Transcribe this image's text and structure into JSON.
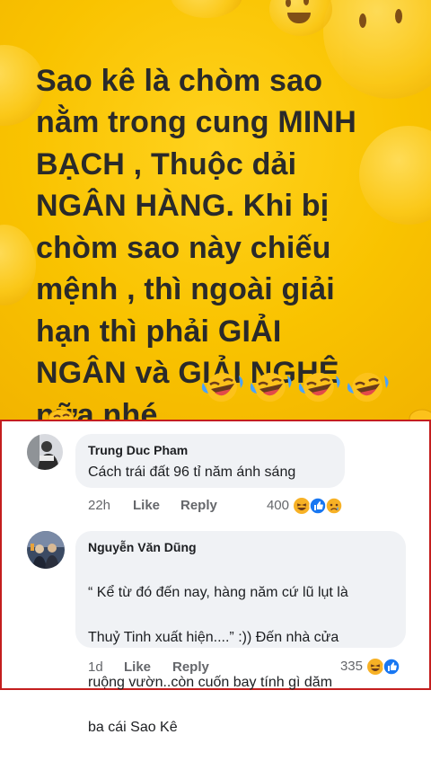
{
  "post": {
    "text": "Sao kê là chòm sao nằm trong cung MINH BẠCH , Thuộc dải NGÂN HÀNG. Khi bị chòm sao này chiếu mệnh , thì ngoài giải hạn thì phải GIẢI NGÂN và GIẢI NGHỆ nữa nhé....",
    "text_lines": [
      "Sao kê là chòm sao",
      "nằm trong cung MINH",
      "BẠCH , Thuộc dải",
      "NGÂN HÀNG. Khi bị",
      "chòm sao này chiếu",
      "mệnh , thì ngoài giải",
      "hạn thì phải GIẢI",
      "NGÂN và GIẢI NGHỆ",
      "nữa nhé...."
    ],
    "emoji": [
      "laughing-emoji",
      "laughing-emoji",
      "laughing-emoji",
      "laughing-emoji"
    ],
    "background_color": "#f9c300",
    "text_color": "#2a2a2a"
  },
  "comments": [
    {
      "author": "Trung Duc Pham",
      "text": "Cách trái đất 96 tỉ năm ánh sáng",
      "time": "22h",
      "like_label": "Like",
      "reply_label": "Reply",
      "reaction_count": "400",
      "reactions": [
        "haha-icon",
        "like-icon",
        "sad-icon"
      ]
    },
    {
      "author": "Nguyễn Văn Dũng",
      "text": "“ Kể từ đó đến nay, hàng năm cứ lũ lụt là Thuỷ Tinh xuất hiện....” :)) Đến nhà cửa ruộng vườn..còn cuốn bay tính gì dăm ba cái Sao Kê",
      "text_lines": [
        "“ Kể từ đó đến nay, hàng năm cứ lũ lụt là",
        "Thuỷ Tinh xuất hiện....” :)) Đến nhà cửa",
        "ruộng vườn..còn cuốn bay tính gì dăm",
        "ba cái Sao Kê"
      ],
      "time": "1d",
      "like_label": "Like",
      "reply_label": "Reply",
      "reaction_count": "335",
      "reactions": [
        "haha-icon",
        "like-icon"
      ]
    }
  ],
  "colors": {
    "panel_border": "#c41e1e",
    "bubble": "#f0f2f5",
    "meta_text": "#65676b",
    "like_blue": "#1877f2"
  }
}
